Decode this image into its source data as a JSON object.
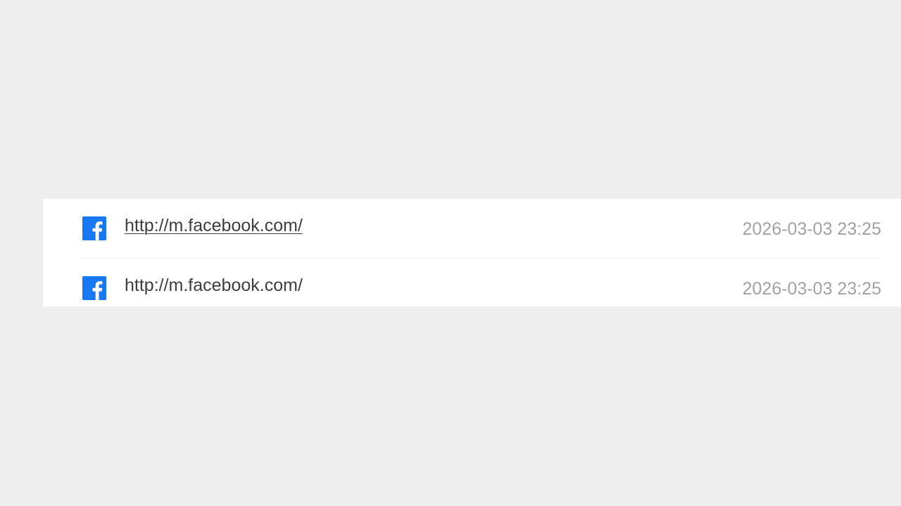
{
  "history": {
    "entries": [
      {
        "icon": "facebook-icon",
        "url": "http://m.facebook.com/",
        "time": "2026-03-03 23:25"
      },
      {
        "icon": "facebook-icon",
        "url": "http://m.facebook.com/",
        "time": "2026-03-03 23:25"
      }
    ]
  },
  "colors": {
    "facebook_blue": "#1877f2",
    "background": "#eeeeee",
    "panel": "#ffffff",
    "url_text": "#3e3e3e",
    "time_text": "#a2a2a2"
  }
}
